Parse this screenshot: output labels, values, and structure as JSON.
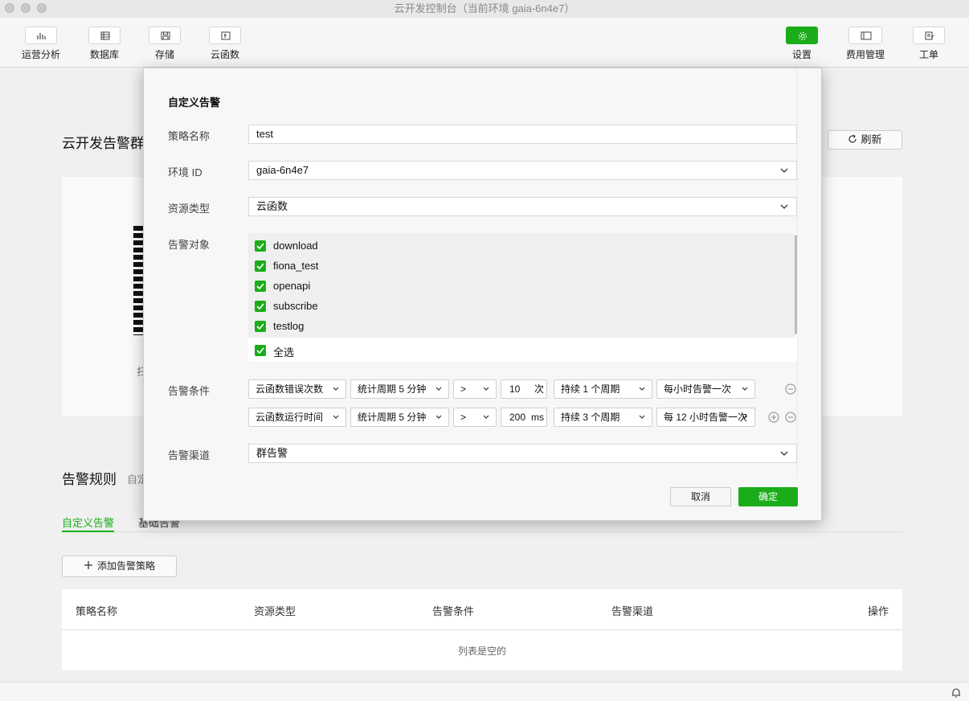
{
  "window": {
    "title": "云开发控制台（当前环境 gaia-6n4e7）"
  },
  "toolbar": {
    "left": [
      {
        "label": "运营分析",
        "icon": "bar-chart-icon"
      },
      {
        "label": "数据库",
        "icon": "database-icon"
      },
      {
        "label": "存储",
        "icon": "storage-icon"
      },
      {
        "label": "云函数",
        "icon": "function-icon"
      }
    ],
    "right": [
      {
        "label": "设置",
        "icon": "gear-icon",
        "active": true
      },
      {
        "label": "费用管理",
        "icon": "billing-icon"
      },
      {
        "label": "工单",
        "icon": "ticket-icon"
      }
    ]
  },
  "background": {
    "group_title": "云开发告警群",
    "refresh_label": "刷新",
    "qr_caption": "扫",
    "rules_title": "告警规则",
    "rules_subtitle": "自定",
    "tabs": [
      "自定义告警",
      "基础告警"
    ],
    "add_button": "添加告警策略",
    "table": {
      "columns": [
        "策略名称",
        "资源类型",
        "告警条件",
        "告警渠道",
        "操作"
      ],
      "empty_text": "列表是空的"
    }
  },
  "modal": {
    "title": "自定义告警",
    "fields": {
      "policy_name": {
        "label": "策略名称",
        "value": "test"
      },
      "env_id": {
        "label": "环境 ID",
        "value": "gaia-6n4e7"
      },
      "resource_type": {
        "label": "资源类型",
        "value": "云函数"
      },
      "targets": {
        "label": "告警对象",
        "items": [
          "download",
          "fiona_test",
          "openapi",
          "subscribe",
          "testlog"
        ],
        "select_all": "全选"
      },
      "conditions": {
        "label": "告警条件",
        "rows": [
          {
            "metric": "云函数错误次数",
            "period": "统计周期 5 分钟",
            "operator": ">",
            "value": "10",
            "unit": "次",
            "duration": "持续 1 个周期",
            "frequency": "每小时告警一次"
          },
          {
            "metric": "云函数运行时间",
            "period": "统计周期 5 分钟",
            "operator": ">",
            "value": "200",
            "unit": "ms",
            "duration": "持续 3 个周期",
            "frequency": "每 12 小时告警一次"
          }
        ]
      },
      "channel": {
        "label": "告警渠道",
        "value": "群告警"
      }
    },
    "cancel_label": "取消",
    "ok_label": "确定"
  },
  "colors": {
    "accent": "#1aad19"
  }
}
